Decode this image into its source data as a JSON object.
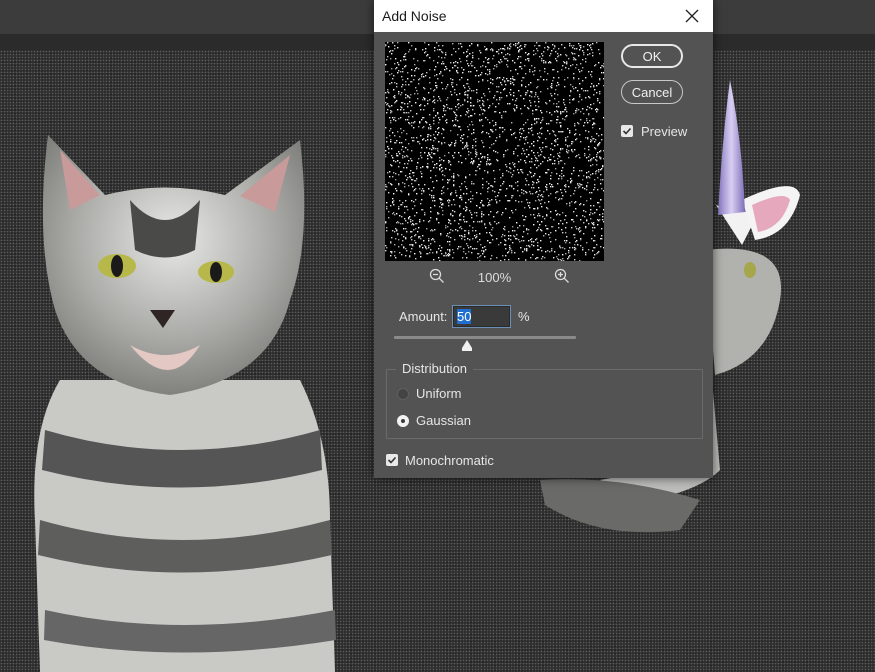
{
  "dialog": {
    "title": "Add Noise",
    "close_icon": "close-icon",
    "ok_label": "OK",
    "cancel_label": "Cancel",
    "preview_label": "Preview",
    "preview_checked": true,
    "zoom_level": "100%",
    "zoom_out_icon": "zoom-out-icon",
    "zoom_in_icon": "zoom-in-icon",
    "amount_label": "Amount:",
    "amount_value": "50",
    "amount_unit": "%",
    "amount_slider_fraction": 0.4,
    "distribution": {
      "legend": "Distribution",
      "options": [
        "Uniform",
        "Gaussian"
      ],
      "selected": "Gaussian"
    },
    "monochromatic_label": "Monochromatic",
    "monochromatic_checked": true
  }
}
